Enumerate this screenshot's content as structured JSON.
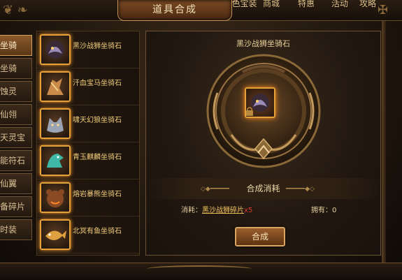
{
  "header": {
    "title": "道具合成",
    "nav_items": [
      "...色宝装",
      "商城",
      "特惠",
      "活动",
      "攻略"
    ]
  },
  "tabs": [
    {
      "label": "坐骑",
      "active": true
    },
    {
      "label": "坐骑",
      "active": false
    },
    {
      "label": "蚀灵",
      "active": false
    },
    {
      "label": "仙翎",
      "active": false
    },
    {
      "label": "天灵宝",
      "active": false
    },
    {
      "label": "能符石",
      "active": false
    },
    {
      "label": "仙翼",
      "active": false
    },
    {
      "label": "备碎片",
      "active": false
    },
    {
      "label": "时装",
      "active": false
    }
  ],
  "items": [
    {
      "name": "黑沙战狮坐骑石",
      "icon": "lion-mount-icon"
    },
    {
      "name": "汗血宝马坐骑石",
      "icon": "horse-mount-icon"
    },
    {
      "name": "啸天幻狼坐骑石",
      "icon": "wolf-mount-icon"
    },
    {
      "name": "青玉麒麟坐骑石",
      "icon": "qilin-mount-icon"
    },
    {
      "name": "熔岩暴熊坐骑石",
      "icon": "bear-mount-icon"
    },
    {
      "name": "北冥有鱼坐骑石",
      "icon": "fish-mount-icon"
    }
  ],
  "detail": {
    "target_name": "黑沙战狮坐骑石",
    "section_label": "合成消耗",
    "cost_prefix": "消耗：",
    "cost_material": "黑沙战狮碎片",
    "cost_qty": "x5",
    "owned_label": "拥有：",
    "owned_value": "0",
    "combine_label": "合成"
  },
  "colors": {
    "accent_gold": "#e6a23a",
    "text_gold": "#f0cc7a",
    "cost_red": "#d83a2a"
  }
}
